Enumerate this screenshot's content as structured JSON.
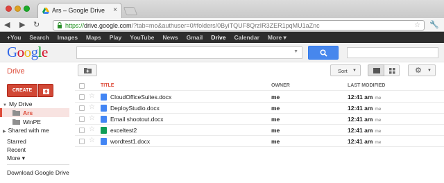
{
  "browser": {
    "tab_title": "Ars – Google Drive",
    "url_scheme": "https://",
    "url_host": "drive.google.com",
    "url_path": "/?tab=mo&authuser=0#folders/0ByiTQUF8QrzIR3ZER1pqMU1aZnc"
  },
  "gbar": {
    "items": [
      {
        "label": "+You",
        "active": false
      },
      {
        "label": "Search",
        "active": false
      },
      {
        "label": "Images",
        "active": false
      },
      {
        "label": "Maps",
        "active": false
      },
      {
        "label": "Play",
        "active": false
      },
      {
        "label": "YouTube",
        "active": false
      },
      {
        "label": "News",
        "active": false
      },
      {
        "label": "Gmail",
        "active": false
      },
      {
        "label": "Drive",
        "active": true
      },
      {
        "label": "Calendar",
        "active": false
      },
      {
        "label": "More ▾",
        "active": false
      }
    ]
  },
  "header": {
    "logo_letters": [
      "G",
      "o",
      "o",
      "g",
      "l",
      "e"
    ],
    "logo_colors": [
      "#3369e8",
      "#d50f25",
      "#eeb211",
      "#3369e8",
      "#009925",
      "#d50f25"
    ]
  },
  "drive": {
    "title": "Drive",
    "create_label": "CREATE",
    "sort_label": "Sort",
    "accent_color": "#dd4b39"
  },
  "sidebar": {
    "my_drive": "My Drive",
    "folders": [
      "Ars",
      "WinPE"
    ],
    "shared": "Shared with me",
    "starred": "Starred",
    "recent": "Recent",
    "more": "More ▾",
    "download": "Download Google Drive"
  },
  "list": {
    "col_title": "TITLE",
    "col_owner": "OWNER",
    "col_modified": "LAST MODIFIED",
    "rows": [
      {
        "name": "CloudOfficeSuites.docx",
        "type": "doc",
        "owner": "me",
        "time": "12:41 am",
        "by": "me"
      },
      {
        "name": "DeployStudio.docx",
        "type": "doc",
        "owner": "me",
        "time": "12:41 am",
        "by": "me"
      },
      {
        "name": "Email shootout.docx",
        "type": "doc",
        "owner": "me",
        "time": "12:41 am",
        "by": "me"
      },
      {
        "name": "exceltest2",
        "type": "sheet",
        "owner": "me",
        "time": "12:41 am",
        "by": "me"
      },
      {
        "name": "wordtest1.docx",
        "type": "doc",
        "owner": "me",
        "time": "12:41 am",
        "by": "me"
      }
    ]
  }
}
